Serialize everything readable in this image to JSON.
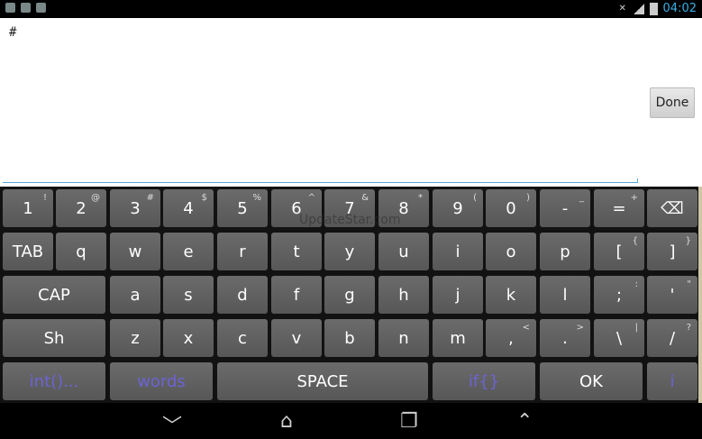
{
  "status": {
    "time": "04:02"
  },
  "editor": {
    "text": "#",
    "done_label": "Done"
  },
  "watermark": "UpdateStar.com",
  "keyboard": {
    "rows": [
      [
        {
          "label": "1",
          "sup": "!"
        },
        {
          "label": "2",
          "sup": "@"
        },
        {
          "label": "3",
          "sup": "#"
        },
        {
          "label": "4",
          "sup": "$"
        },
        {
          "label": "5",
          "sup": "%"
        },
        {
          "label": "6",
          "sup": "^"
        },
        {
          "label": "7",
          "sup": "&"
        },
        {
          "label": "8",
          "sup": "*"
        },
        {
          "label": "9",
          "sup": "("
        },
        {
          "label": "0",
          "sup": ")"
        },
        {
          "label": "-",
          "sup": "_"
        },
        {
          "label": "=",
          "sup": "+"
        },
        {
          "label": "⌫",
          "sup": "",
          "icon": "backspace-icon"
        }
      ],
      [
        {
          "label": "TAB",
          "sup": ""
        },
        {
          "label": "q",
          "sup": ""
        },
        {
          "label": "w",
          "sup": ""
        },
        {
          "label": "e",
          "sup": ""
        },
        {
          "label": "r",
          "sup": ""
        },
        {
          "label": "t",
          "sup": ""
        },
        {
          "label": "y",
          "sup": ""
        },
        {
          "label": "u",
          "sup": ""
        },
        {
          "label": "i",
          "sup": ""
        },
        {
          "label": "o",
          "sup": ""
        },
        {
          "label": "p",
          "sup": ""
        },
        {
          "label": "[",
          "sup": "{"
        },
        {
          "label": "]",
          "sup": "}"
        }
      ],
      [
        {
          "label": "CAP",
          "sup": ""
        },
        {
          "label": "a",
          "sup": ""
        },
        {
          "label": "s",
          "sup": ""
        },
        {
          "label": "d",
          "sup": ""
        },
        {
          "label": "f",
          "sup": ""
        },
        {
          "label": "g",
          "sup": ""
        },
        {
          "label": "h",
          "sup": ""
        },
        {
          "label": "j",
          "sup": ""
        },
        {
          "label": "k",
          "sup": ""
        },
        {
          "label": "l",
          "sup": ""
        },
        {
          "label": ";",
          "sup": ":"
        },
        {
          "label": "'",
          "sup": "\""
        }
      ],
      [
        {
          "label": "Sh",
          "sup": ""
        },
        {
          "label": "z",
          "sup": ""
        },
        {
          "label": "x",
          "sup": ""
        },
        {
          "label": "c",
          "sup": ""
        },
        {
          "label": "v",
          "sup": ""
        },
        {
          "label": "b",
          "sup": ""
        },
        {
          "label": "n",
          "sup": ""
        },
        {
          "label": "m",
          "sup": ""
        },
        {
          "label": ",",
          "sup": "<"
        },
        {
          "label": ".",
          "sup": ">"
        },
        {
          "label": "\\",
          "sup": "|"
        },
        {
          "label": "/",
          "sup": "?"
        }
      ],
      [
        {
          "label": "int()...",
          "sup": "",
          "purple": true
        },
        {
          "label": "words",
          "sup": "",
          "purple": true
        },
        {
          "label": "SPACE",
          "sup": ""
        },
        {
          "label": "if{}",
          "sup": "",
          "purple": true
        },
        {
          "label": "OK",
          "sup": ""
        },
        {
          "label": "i",
          "sup": "",
          "purple": true
        }
      ]
    ]
  },
  "colors": {
    "accent": "#3ab0e6",
    "key_bg": "#5f5f5f",
    "purple_text": "#6b63d6"
  }
}
